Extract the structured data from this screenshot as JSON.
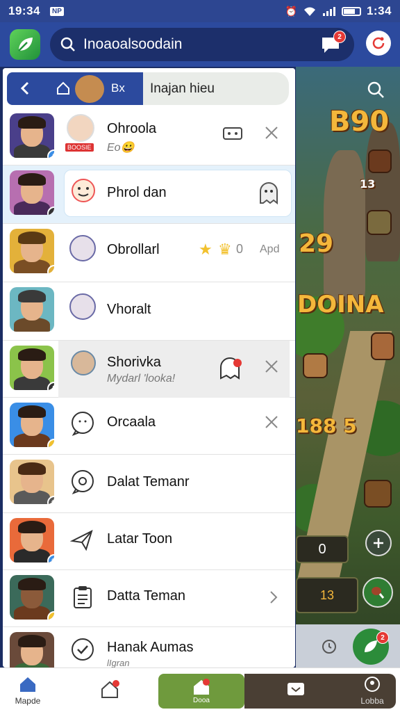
{
  "statusbar": {
    "time": "19:34",
    "sim_label": "NP",
    "right_time": "1:34"
  },
  "header": {
    "search_text": "Inoaoalsoodain",
    "notif_count": "2"
  },
  "panel": {
    "back_label": "Bx",
    "tab_label": "Inajan hieu",
    "rows": [
      {
        "title": "Ohroola",
        "sub": "Eo😀",
        "tag": "BOOSIE"
      },
      {
        "title": "Phrol dan",
        "sub": ""
      },
      {
        "title": "Obrollarl",
        "sub": "",
        "count": "0",
        "extra": "Apd"
      },
      {
        "title": "Vhoralt",
        "sub": ""
      },
      {
        "title": "Shorivka",
        "sub": "Mydarl 'looka!"
      },
      {
        "title": "Orcaala",
        "sub": ""
      },
      {
        "title": "Dalat Temanr",
        "sub": ""
      },
      {
        "title": "Latar Toon",
        "sub": ""
      },
      {
        "title": "Datta Teman",
        "sub": ""
      },
      {
        "title": "Hanak Aumas",
        "sub": "lIgran"
      }
    ]
  },
  "game": {
    "title1": "B90",
    "title2": "29",
    "title3": "DOINA",
    "counter1": "13",
    "counter2": "188 5",
    "slot_value": "0",
    "counter3": "13"
  },
  "fab": {
    "badge": "2"
  },
  "bottomnav": {
    "items": [
      {
        "label": "Mapde"
      },
      {
        "label": ""
      },
      {
        "label": "Dooa",
        "badge": "1"
      },
      {
        "label": ""
      },
      {
        "label": "Lobba"
      }
    ]
  },
  "colors": {
    "brand": "#2c4a9e",
    "accent_green": "#6f9a3d",
    "badge_red": "#e53935"
  }
}
